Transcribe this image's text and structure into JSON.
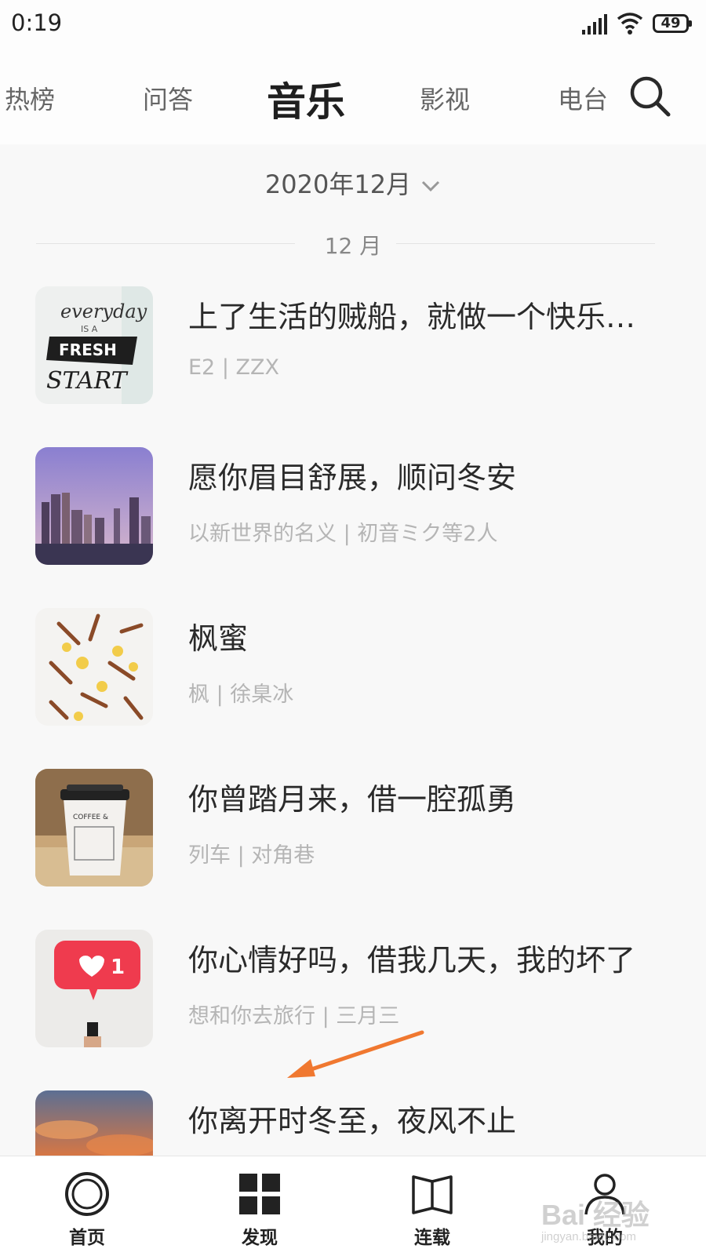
{
  "status_bar": {
    "time": "0:19",
    "battery": "49"
  },
  "top_nav": {
    "tabs": [
      {
        "label": "热榜"
      },
      {
        "label": "问答"
      },
      {
        "label": "音乐",
        "active": true
      },
      {
        "label": "影视"
      },
      {
        "label": "电台"
      }
    ],
    "search_icon": "search-icon"
  },
  "filter": {
    "month_picker": "2020年12月",
    "section_label": "12 月"
  },
  "songs": [
    {
      "title": "上了生活的贼船，就做一个快乐…",
      "subtitle": "E2 | ZZX",
      "cover": "everyday-fresh-start-lettering",
      "cover_text": [
        "everyday",
        "IS A",
        "FRESH",
        "START"
      ]
    },
    {
      "title": "愿你眉目舒展，顺问冬安",
      "subtitle": "以新世界的名义 | 初音ミク等2人",
      "cover": "city-skyline-dusk"
    },
    {
      "title": "枫蜜",
      "subtitle": "枫 | 徐臬冰",
      "cover": "cinnamon-lemon-flatlay"
    },
    {
      "title": "你曾踏月来，借一腔孤勇",
      "subtitle": "列车 | 对角巷",
      "cover": "coffee-cup",
      "cover_text": [
        "COFFEE &"
      ]
    },
    {
      "title": "你心情好吗，借我几天，我的坏了",
      "subtitle": "想和你去旅行 | 三月三",
      "cover": "heart-like-notification",
      "cover_text": [
        "1"
      ]
    },
    {
      "title": "你离开时冬至，夜风不止",
      "subtitle": "",
      "cover": "sunset-clouds"
    }
  ],
  "bottom_nav": [
    {
      "label": "首页",
      "icon": "home-ring-icon"
    },
    {
      "label": "发现",
      "icon": "grid-icon"
    },
    {
      "label": "连载",
      "icon": "book-icon"
    },
    {
      "label": "我的",
      "icon": "person-icon"
    }
  ],
  "watermark": {
    "text": "Bai 经验",
    "sub": "jingyan.baidu.com"
  },
  "colors": {
    "annotation_arrow": "#f07830",
    "title_text": "#2a2a2a",
    "subtitle_text": "#b5b5b5"
  }
}
